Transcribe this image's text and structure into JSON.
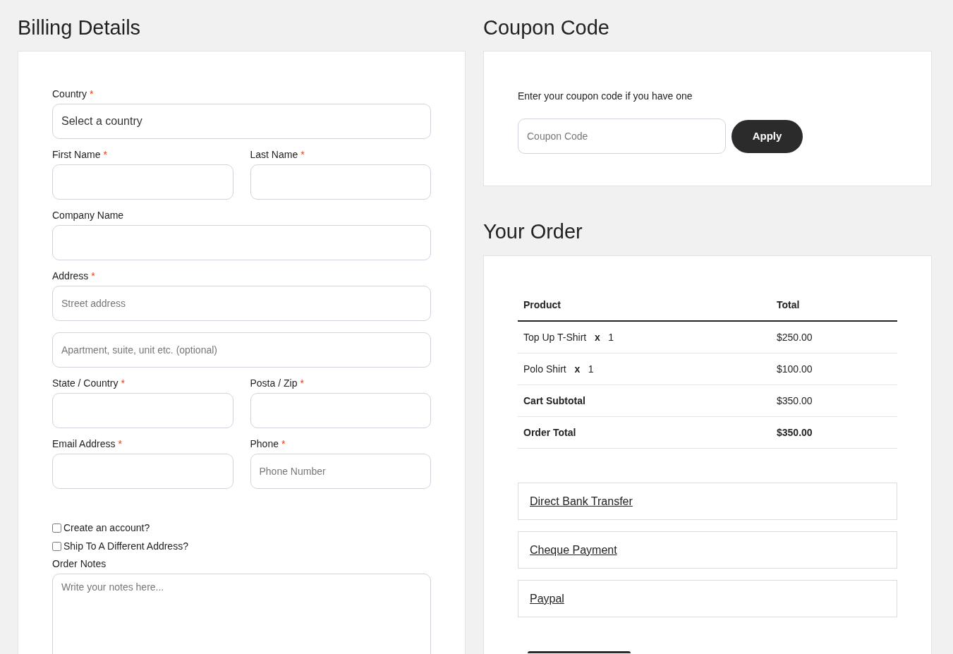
{
  "billing": {
    "title": "Billing Details",
    "rows": [
      [
        {
          "kind": "select",
          "label": "Country",
          "mark": "*",
          "value": "Select a country"
        }
      ],
      [
        {
          "kind": "text",
          "label": "First Name",
          "mark": "*"
        },
        {
          "kind": "text",
          "label": "Last Name",
          "mark": "*"
        }
      ],
      [
        {
          "kind": "text",
          "label": "Company Name"
        }
      ],
      [
        {
          "kind": "text",
          "label": "Address",
          "mark": "*",
          "placeholder": "Street address"
        }
      ],
      [
        {
          "kind": "text",
          "placeholder": "Apartment, suite, unit etc. (optional)"
        }
      ],
      [
        {
          "kind": "text",
          "label": "State / Country",
          "mark": "*"
        },
        {
          "kind": "text",
          "label": "Posta / Zip",
          "mark": "*"
        }
      ],
      [
        {
          "kind": "text",
          "label": "Email Address",
          "mark": "*"
        },
        {
          "kind": "text",
          "label": "Phone",
          "mark": "*",
          "placeholder": "Phone Number"
        }
      ]
    ],
    "checkboxes": [
      {
        "label": "Create an account?",
        "checked": false
      },
      {
        "label": "Ship To A Different Address?",
        "checked": false
      }
    ],
    "notes": {
      "label": "Order Notes",
      "placeholder": "Write your notes here..."
    }
  },
  "coupon": {
    "title": "Coupon Code",
    "hint": "Enter your coupon code if you have one",
    "placeholder": "Coupon Code",
    "button": "Apply"
  },
  "order": {
    "title": "Your Order",
    "columns": [
      "Product",
      "Total"
    ],
    "rows": [
      {
        "kind": "item",
        "product": "Top Up T-Shirt   **x**   1",
        "total": "$250.00"
      },
      {
        "kind": "item",
        "product": "Polo Shirt   **x**   1",
        "total": "$100.00"
      },
      {
        "kind": "subtotal",
        "product": "Cart Subtotal",
        "total": "$350.00"
      },
      {
        "kind": "total",
        "product": "Order Total",
        "total": "$350.00"
      }
    ],
    "payments": [
      "Direct Bank Transfer",
      "Cheque Payment",
      "Paypal"
    ]
  }
}
